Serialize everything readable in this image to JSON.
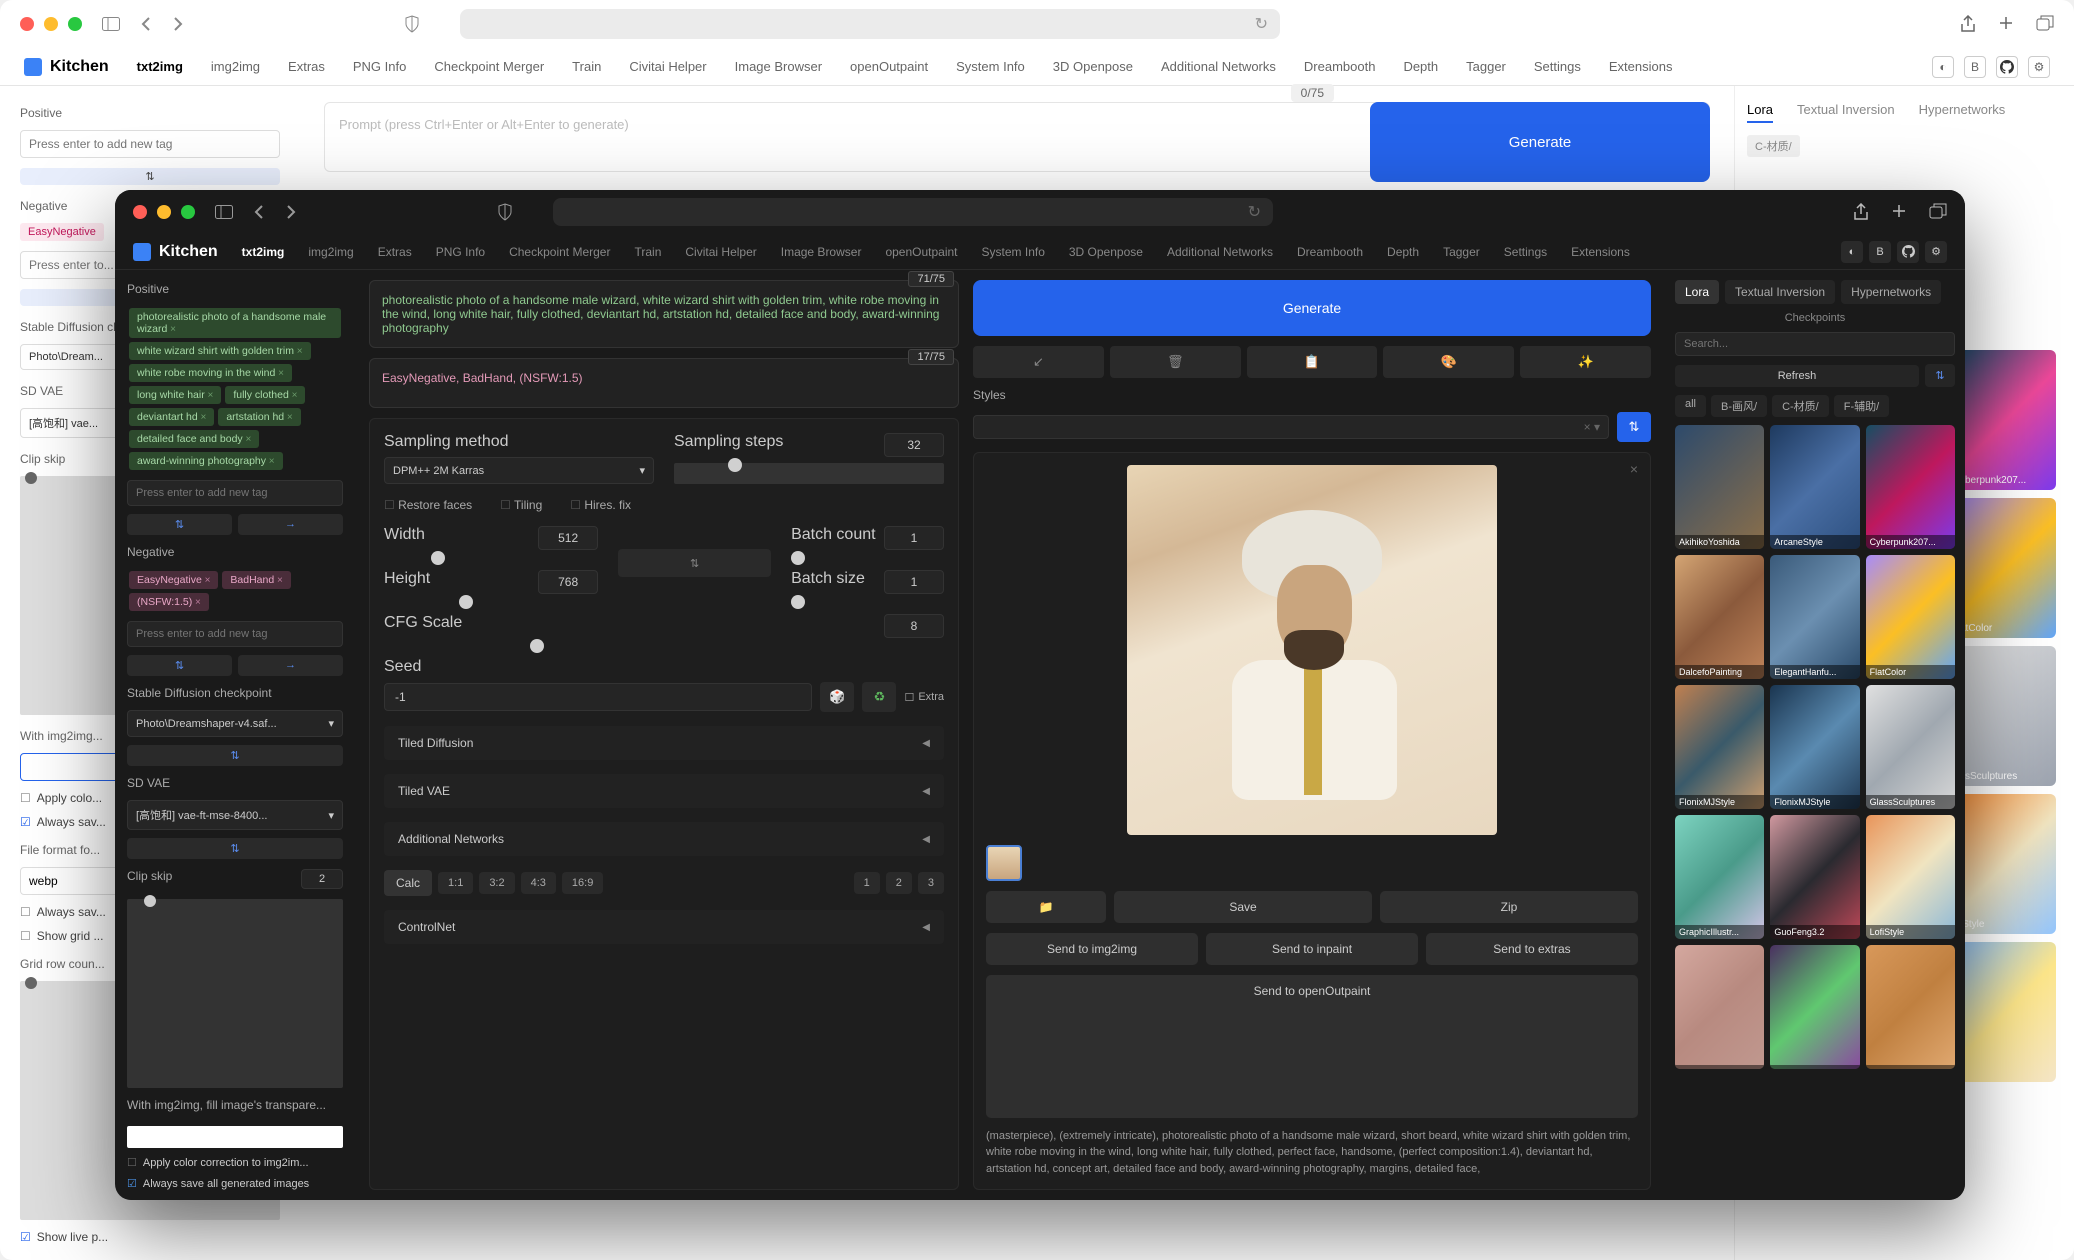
{
  "app_name": "Kitchen",
  "light": {
    "tabs": [
      "txt2img",
      "img2img",
      "Extras",
      "PNG Info",
      "Checkpoint Merger",
      "Train",
      "Civitai Helper",
      "Image Browser",
      "openOutpaint",
      "System Info",
      "3D Openpose",
      "Additional Networks",
      "Dreambooth",
      "Depth",
      "Tagger",
      "Settings",
      "Extensions"
    ],
    "active_tab": "txt2img",
    "counter": "0/75",
    "generate": "Generate",
    "prompt_placeholder": "Prompt (press Ctrl+Enter or Alt+Enter to generate)",
    "side": {
      "positive": "Positive",
      "positive_ph": "Press enter to add new tag",
      "negative": "Negative",
      "neg_tags": [
        "EasyNegative"
      ],
      "sd_ckpt": "Stable Diffusion checkpoint",
      "sd_ckpt_val": "Photo\\Dream...",
      "sd_vae": "SD VAE",
      "sd_vae_val": "[高饱和] vae...",
      "clip_skip": "Clip skip",
      "with_img": "With img2img...",
      "apply_color": "Apply colo...",
      "always_save": "Always sav...",
      "ff_label": "File format fo...",
      "ff_val": "webp",
      "always_save2": "Always sav...",
      "show_grid": "Show grid ...",
      "grid_row": "Grid row coun...",
      "show_live": "Show live p..."
    },
    "subtabs": [
      "Lora",
      "Textual Inversion",
      "Hypernetworks"
    ],
    "gallery": [
      {
        "name": "yberpunk207...",
        "bg": "linear-gradient(135deg,#1a4d6b,#ec4899,#7c3aed)"
      },
      {
        "name": "atColor",
        "bg": "linear-gradient(135deg,#a78bfa,#fbbf24,#60a5fa)"
      },
      {
        "name": "ssSculptures",
        "bg": "linear-gradient(135deg,#e5e5e5,#9ca3af)"
      },
      {
        "name": "iStyle",
        "bg": "linear-gradient(135deg,#fb923c,#f0e4c0,#93c5fd)"
      },
      {
        "name": "",
        "bg": "linear-gradient(135deg,#93c5fd,#fde68a,#f5e6c8)"
      }
    ],
    "filter_labels": [
      "C-材质/"
    ]
  },
  "dark": {
    "tabs": [
      "txt2img",
      "img2img",
      "Extras",
      "PNG Info",
      "Checkpoint Merger",
      "Train",
      "Civitai Helper",
      "Image Browser",
      "openOutpaint",
      "System Info",
      "3D Openpose",
      "Additional Networks",
      "Dreambooth",
      "Depth",
      "Tagger",
      "Settings",
      "Extensions"
    ],
    "active_tab": "txt2img",
    "pos_count": "71/75",
    "neg_count": "17/75",
    "prompt_pos": "photorealistic photo of a handsome male wizard, white wizard shirt with golden trim, white robe moving in the wind, long white hair, fully clothed, deviantart hd, artstation hd, detailed face and body, award-winning photography",
    "prompt_neg": "EasyNegative, BadHand, (NSFW:1.5)",
    "generate": "Generate",
    "styles_label": "Styles",
    "left": {
      "positive": "Positive",
      "pos_tags": [
        "photorealistic photo of a handsome male wizard",
        "white wizard shirt with golden trim",
        "white robe moving in the wind",
        "long white hair",
        "fully clothed",
        "deviantart hd",
        "artstation hd",
        "detailed face and body",
        "award-winning photography"
      ],
      "tag_ph": "Press enter to add new tag",
      "negative": "Negative",
      "neg_tags": [
        "EasyNegative",
        "BadHand",
        "(NSFW:1.5)"
      ],
      "sd_ckpt": "Stable Diffusion checkpoint",
      "sd_ckpt_val": "Photo\\Dreamshaper-v4.saf...",
      "sd_vae": "SD VAE",
      "sd_vae_val": "[高饱和] vae-ft-mse-8400...",
      "clip_skip": "Clip skip",
      "clip_skip_val": "2",
      "with_img": "With img2img, fill image's transpare...",
      "apply_color": "Apply color correction to img2im...",
      "always_save": "Always save all generated images"
    },
    "settings": {
      "sampling_method": "Sampling method",
      "method_val": "DPM++ 2M Karras",
      "sampling_steps": "Sampling steps",
      "steps_val": "32",
      "restore": "Restore faces",
      "tiling": "Tiling",
      "hires": "Hires. fix",
      "width": "Width",
      "width_val": "512",
      "height": "Height",
      "height_val": "768",
      "batch_count": "Batch count",
      "bc_val": "1",
      "batch_size": "Batch size",
      "bs_val": "1",
      "cfg": "CFG Scale",
      "cfg_val": "8",
      "seed": "Seed",
      "seed_val": "-1",
      "extra": "Extra",
      "tiled_diff": "Tiled Diffusion",
      "tiled_vae": "Tiled VAE",
      "addl_net": "Additional Networks",
      "calc": "Calc",
      "ratios": [
        "1:1",
        "3:2",
        "4:3",
        "16:9"
      ],
      "nums": [
        "1",
        "2",
        "3"
      ],
      "controlnet": "ControlNet"
    },
    "output": {
      "save": "Save",
      "zip": "Zip",
      "send_img2img": "Send to img2img",
      "send_inpaint": "Send to inpaint",
      "send_extras": "Send to extras",
      "send_open": "Send to openOutpaint",
      "meta": "(masterpiece), (extremely intricate), photorealistic photo of a handsome male wizard, short beard, white wizard shirt with golden trim, white robe moving in the wind, long white hair, fully clothed, perfect face, handsome, (perfect composition:1.4), deviantart hd, artstation hd, concept art, detailed face and body, award-winning photography, margins, detailed face,"
    },
    "gallery": {
      "tabs": [
        "Lora",
        "Textual Inversion",
        "Hypernetworks"
      ],
      "active_tab": "Lora",
      "sub": "Checkpoints",
      "search_ph": "Search...",
      "refresh": "Refresh",
      "filters": [
        "all",
        "B-画风/",
        "C-材质/",
        "F-辅助/"
      ],
      "cards": [
        {
          "name": "AkihikoYoshida",
          "bg": "linear-gradient(135deg,#2d4a6b,#8b6f4a)"
        },
        {
          "name": "ArcaneStyle",
          "bg": "linear-gradient(135deg,#1e3a5f,#4a6fa5,#2d5080)"
        },
        {
          "name": "Cyberpunk207...",
          "bg": "linear-gradient(135deg,#164e63,#be185d,#7c3aed)"
        },
        {
          "name": "DalcefoPainting",
          "bg": "linear-gradient(135deg,#d4a574,#8b5a3c,#c0845a)"
        },
        {
          "name": "ElegantHanfu...",
          "bg": "linear-gradient(135deg,#3a5a7a,#6b8fb0,#2a4a6a)"
        },
        {
          "name": "FlatColor",
          "bg": "linear-gradient(135deg,#a78bfa,#fbbf24,#60a5fa)"
        },
        {
          "name": "FlonixMJStyle",
          "bg": "linear-gradient(135deg,#c08050,#3a5a6a,#d0a070)"
        },
        {
          "name": "FlonixMJStyle",
          "bg": "linear-gradient(135deg,#1a3550,#5a8ab0,#203a55)"
        },
        {
          "name": "GlassSculptures",
          "bg": "linear-gradient(135deg,#e0e0e0,#a0a8b0,#d8d8d8)"
        },
        {
          "name": "GraphicIllustr...",
          "bg": "linear-gradient(135deg,#7dd3c0,#4a9b8a,#d4c5e8)"
        },
        {
          "name": "GuoFeng3.2",
          "bg": "linear-gradient(135deg,#d0989f,#2a2a30,#c04858)"
        },
        {
          "name": "LofiStyle",
          "bg": "linear-gradient(135deg,#e8945a,#f0e4c0,#8bb8d8)"
        },
        {
          "name": "",
          "bg": "linear-gradient(135deg,#d4a89f,#b88a80,#c0988f)"
        },
        {
          "name": "",
          "bg": "linear-gradient(135deg,#4a3060,#60c870,#8a4aa0)"
        },
        {
          "name": "",
          "bg": "linear-gradient(135deg,#d8985a,#c08040,#e0a870)"
        }
      ]
    }
  }
}
